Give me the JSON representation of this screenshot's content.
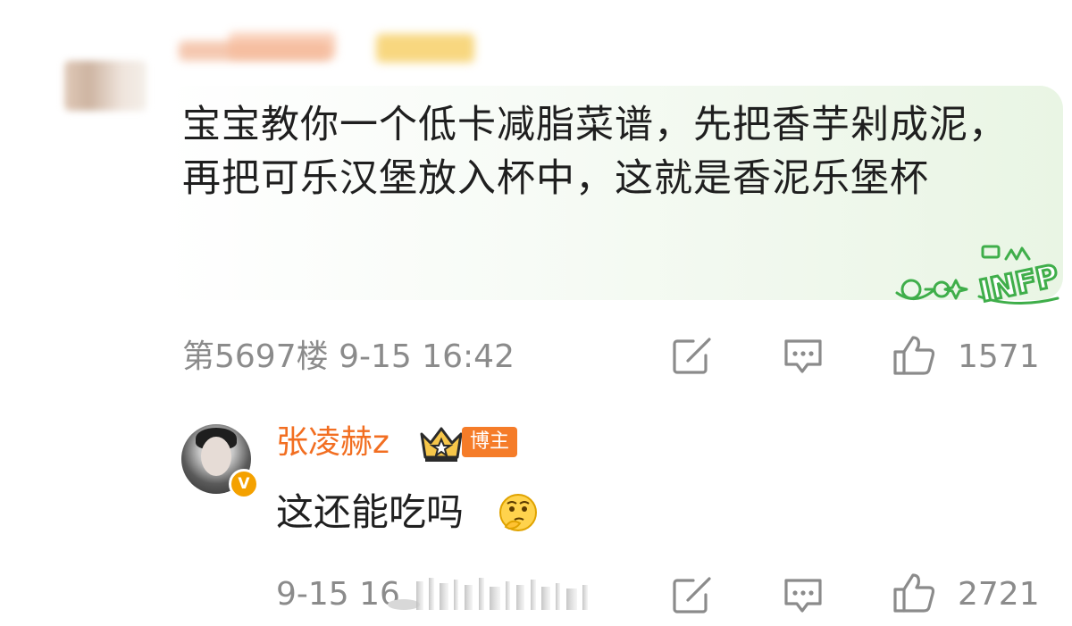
{
  "comment": {
    "text": "宝宝教你一个低卡减脂菜谱，先把香芋剁成泥，再把可乐汉堡放入杯中，这就是香泥乐堡杯",
    "sticker_label": "INFP",
    "floor": "第5697楼",
    "time": "9-15 16:42",
    "like_count": "1571"
  },
  "reply": {
    "author": "张凌赫z",
    "badge": "博主",
    "verified_mark": "V",
    "text": "这还能吃吗",
    "time": "9-15 16",
    "like_count": "2721"
  },
  "icons": [
    "edit-icon",
    "comment-icon",
    "thumbs-up-icon",
    "crown-icon",
    "emoji-icon"
  ],
  "colors": {
    "meta_gray": "#8b8b8b",
    "author_orange": "#f26e21",
    "badge_orange": "#f57c29",
    "bubble_green": "#e9f5e4"
  }
}
